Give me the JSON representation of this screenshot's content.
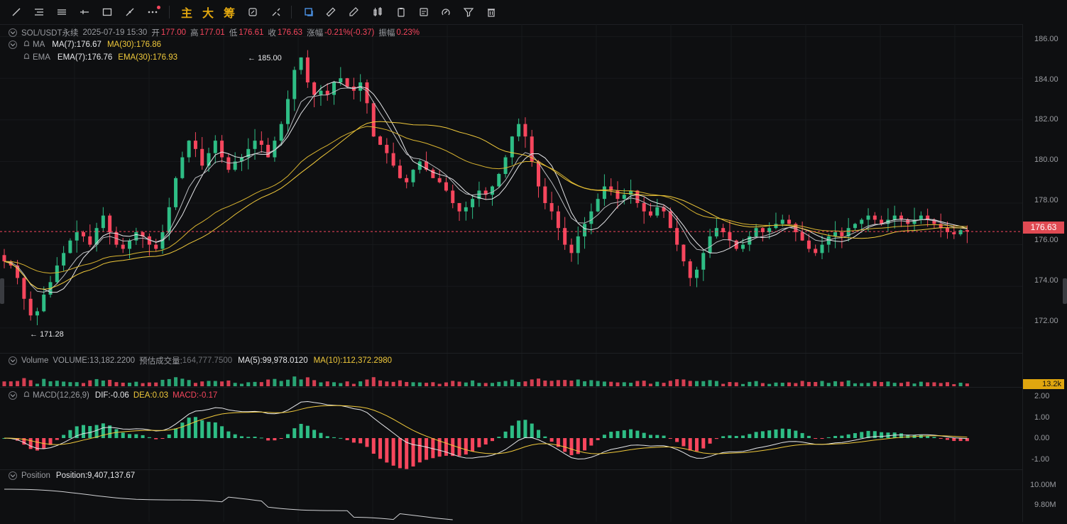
{
  "toolbar": {
    "tools": [
      "trend-line-icon",
      "horizontal-lines-icon",
      "parallel-channel-icon",
      "horizontal-ray-icon",
      "rectangle-icon",
      "brush-icon",
      "more-icon"
    ],
    "text_buttons": [
      "主",
      "大",
      "筹"
    ],
    "right_tools": [
      "refresh-compare-icon",
      "eraser-icon",
      "layers-icon",
      "ruler-icon",
      "pencil-edit-icon",
      "candle-type-icon",
      "clipboard-icon",
      "note-icon",
      "magnet-icon",
      "filter-icon",
      "trash-icon"
    ]
  },
  "header": {
    "symbol": "SOL/USDT永续",
    "datetime": "2025-07-19 15:30",
    "open_label": "开",
    "open": "177.00",
    "high_label": "高",
    "high": "177.01",
    "low_label": "低",
    "low": "176.61",
    "close_label": "收",
    "close": "176.63",
    "change_label": "涨幅",
    "change": "-0.21%(-0.37)",
    "amp_label": "振幅",
    "amp": "0.23%"
  },
  "ma": {
    "name": "MA",
    "ma7": "MA(7):176.67",
    "ma30": "MA(30):176.86"
  },
  "ema": {
    "name": "EMA",
    "ema7": "EMA(7):176.76",
    "ema30": "EMA(30):176.93"
  },
  "volume": {
    "name": "Volume",
    "value": "VOLUME:13,182.2200",
    "est_label": "预估成交量:",
    "est": "164,777.7500",
    "ma5": "MA(5):99,978.0120",
    "ma10": "MA(10):112,372.2980",
    "tag": "13.2k"
  },
  "macd": {
    "name": "MACD(12,26,9)",
    "dif": "DIF:-0.06",
    "dea": "DEA:0.03",
    "macd": "MACD:-0.17"
  },
  "position": {
    "name": "Position",
    "value": "Position:9,407,137.67"
  },
  "price_axis": [
    "186.00",
    "184.00",
    "182.00",
    "180.00",
    "178.00",
    "176.00",
    "174.00",
    "172.00"
  ],
  "macd_axis": [
    "2.00",
    "1.00",
    "0.00",
    "-1.00"
  ],
  "position_axis": [
    "10.00M",
    "9.80M"
  ],
  "current_price": "176.63",
  "annotations": {
    "high": "185.00",
    "low": "171.28"
  },
  "colors": {
    "up": "#2ebd85",
    "down": "#f6465d",
    "ma_yellow": "#f0c93b",
    "ma_white": "#e6e7ea",
    "bg": "#0e0f11"
  },
  "chart_data": {
    "type": "candlestick",
    "price_range": [
      170.8,
      186.6
    ],
    "closes": [
      175.2,
      175.0,
      174.4,
      173.4,
      172.6,
      172.8,
      173.6,
      174.2,
      175.0,
      175.6,
      176.2,
      176.6,
      176.4,
      176.0,
      176.8,
      177.4,
      176.6,
      176.0,
      175.8,
      176.2,
      176.6,
      176.4,
      176.0,
      175.8,
      176.6,
      177.8,
      179.2,
      180.2,
      181.0,
      180.6,
      179.8,
      180.4,
      181.0,
      180.2,
      179.6,
      180.0,
      180.2,
      180.6,
      181.0,
      180.8,
      180.2,
      181.0,
      181.8,
      183.0,
      184.4,
      185.0,
      183.8,
      183.2,
      183.4,
      183.2,
      183.8,
      184.0,
      183.6,
      183.4,
      183.8,
      182.8,
      181.2,
      180.8,
      180.4,
      179.8,
      179.2,
      179.0,
      179.6,
      180.0,
      179.6,
      179.2,
      179.0,
      178.6,
      178.0,
      177.6,
      177.8,
      178.2,
      178.6,
      178.4,
      178.8,
      179.4,
      180.2,
      181.2,
      181.8,
      181.2,
      180.0,
      178.8,
      178.0,
      177.6,
      176.8,
      176.0,
      175.6,
      176.4,
      177.0,
      177.6,
      178.2,
      178.8,
      178.6,
      178.2,
      178.4,
      178.6,
      178.0,
      177.6,
      177.4,
      177.8,
      177.6,
      176.8,
      176.0,
      175.2,
      174.4,
      174.8,
      175.6,
      176.4,
      176.8,
      176.6,
      176.2,
      175.8,
      176.0,
      176.4,
      176.8,
      176.6,
      176.8,
      177.0,
      177.2,
      177.0,
      176.6,
      176.2,
      175.8,
      175.6,
      176.0,
      176.4,
      176.6,
      176.4,
      176.8,
      177.0,
      177.2,
      177.4,
      177.2,
      177.0,
      177.2,
      177.4,
      177.2,
      177.0,
      177.2,
      177.4,
      177.2,
      177.0,
      176.8,
      176.6,
      176.5,
      176.7,
      176.63
    ],
    "macd_range": [
      -1.35,
      2.25
    ],
    "position_range": [
      9.7,
      10.1
    ]
  }
}
